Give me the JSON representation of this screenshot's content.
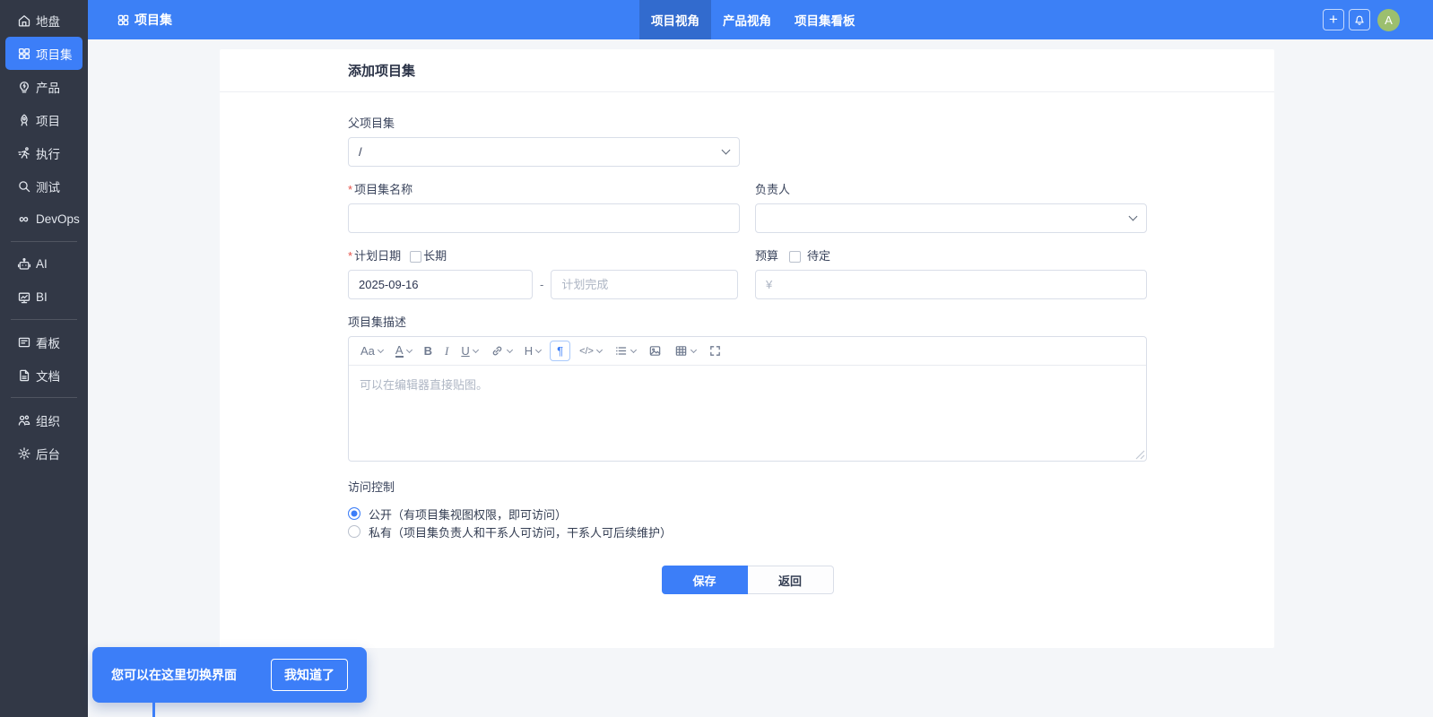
{
  "app": {
    "accent": "#3c7ef8",
    "header_blue": "#3c80f6",
    "sidebar_bg": "#323846",
    "avatar_green": "#9cbf6e"
  },
  "sidebar": {
    "items": [
      {
        "label": "地盘"
      },
      {
        "label": "项目集",
        "active": true
      },
      {
        "label": "产品"
      },
      {
        "label": "项目"
      },
      {
        "label": "执行"
      },
      {
        "label": "测试"
      },
      {
        "label": "DevOps"
      },
      {
        "label": "AI"
      },
      {
        "label": "BI"
      },
      {
        "label": "看板"
      },
      {
        "label": "文档"
      },
      {
        "label": "组织"
      },
      {
        "label": "后台"
      }
    ]
  },
  "topbar": {
    "title": "项目集",
    "tabs": [
      {
        "label": "项目视角",
        "active": true
      },
      {
        "label": "产品视角",
        "active": false
      },
      {
        "label": "项目集看板",
        "active": false
      }
    ],
    "avatar": "A"
  },
  "page": {
    "title": "添加项目集"
  },
  "form": {
    "parent": {
      "label": "父项目集",
      "value": "/"
    },
    "name": {
      "label": "项目集名称",
      "required": "*",
      "value": ""
    },
    "owner": {
      "label": "负责人",
      "value": ""
    },
    "plan": {
      "label": "计划日期",
      "required": "*",
      "long_term": "长期",
      "start": "2025-09-16",
      "separator": "-",
      "end_placeholder": "计划完成"
    },
    "budget": {
      "label": "预算",
      "tbd": "待定",
      "currency": "¥",
      "value": ""
    },
    "description": {
      "label": "项目集描述",
      "placeholder": "可以在编辑器直接贴图。"
    },
    "editor_glyphs": {
      "fontsize": "Aa",
      "fontcolor": "A",
      "bold": "B",
      "italic": "I",
      "underline": "U",
      "heading": "H",
      "paragraph": "¶",
      "code": "</>"
    },
    "access": {
      "label": "访问控制",
      "options": [
        {
          "label": "公开（有项目集视图权限，即可访问）",
          "selected": true
        },
        {
          "label": "私有（项目集负责人和干系人可访问，干系人可后续维护）",
          "selected": false
        }
      ]
    },
    "actions": {
      "save": "保存",
      "back": "返回"
    }
  },
  "tooltip": {
    "text": "您可以在这里切换界面",
    "button": "我知道了"
  }
}
